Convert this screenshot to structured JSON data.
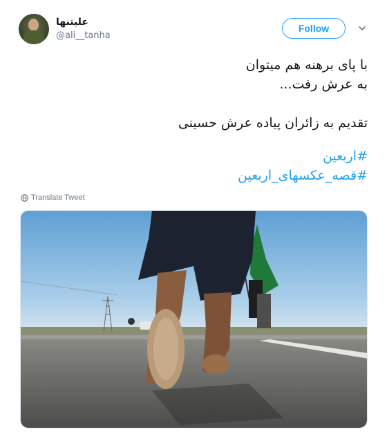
{
  "user": {
    "display_name": "علیتنها",
    "handle": "@ali__tanha"
  },
  "follow_button": {
    "label": "Follow"
  },
  "menu": {
    "icon": "chevron-down-icon"
  },
  "tweet": {
    "line1": "با پای برهنه هم میتوان",
    "line2": "به عرش رفت...",
    "line3": "تقدیم به زائران پیاده عرش حسینی",
    "hashtags": [
      "#اربعین",
      "#قصه_عکسهای_اربعین"
    ]
  },
  "translate": {
    "label": "Translate Tweet",
    "icon": "globe-icon"
  },
  "media": {
    "icon": "photo"
  },
  "colors": {
    "accent": "#1da1f2",
    "secondary_text": "#657786",
    "flag": "#1f7a3a"
  }
}
